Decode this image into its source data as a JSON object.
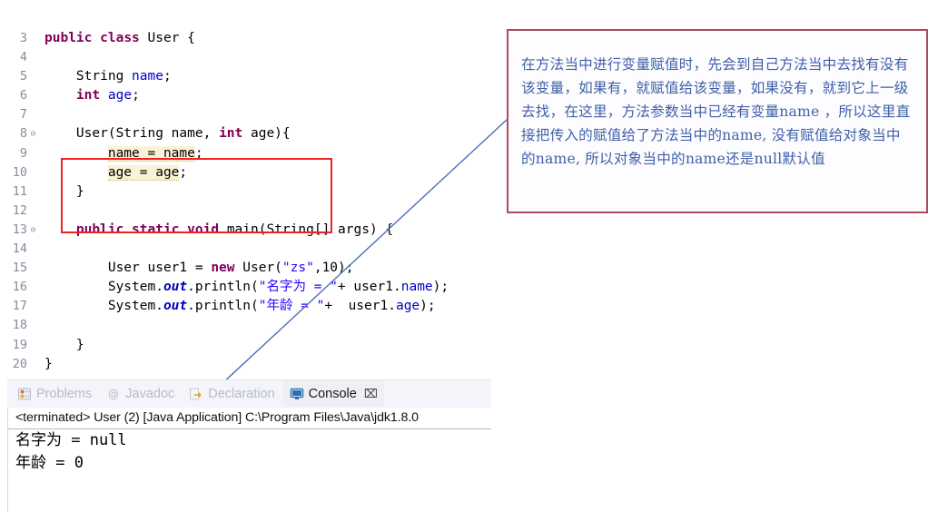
{
  "editor": {
    "name": "java-code-editor",
    "lines": [
      {
        "num": "3",
        "fold": false,
        "tokens": [
          {
            "t": "public",
            "c": "kw"
          },
          {
            "t": " ",
            "c": "plain"
          },
          {
            "t": "class",
            "c": "kw"
          },
          {
            "t": " User {",
            "c": "plain"
          }
        ]
      },
      {
        "num": "4",
        "fold": false,
        "tokens": [
          {
            "t": "",
            "c": "plain"
          }
        ]
      },
      {
        "num": "5",
        "fold": false,
        "tokens": [
          {
            "t": "    String ",
            "c": "plain"
          },
          {
            "t": "name",
            "c": "fld"
          },
          {
            "t": ";",
            "c": "plain"
          }
        ]
      },
      {
        "num": "6",
        "fold": false,
        "tokens": [
          {
            "t": "    ",
            "c": "plain"
          },
          {
            "t": "int",
            "c": "kw"
          },
          {
            "t": " ",
            "c": "plain"
          },
          {
            "t": "age",
            "c": "fld"
          },
          {
            "t": ";",
            "c": "plain"
          }
        ]
      },
      {
        "num": "7",
        "fold": false,
        "tokens": [
          {
            "t": "",
            "c": "plain"
          }
        ]
      },
      {
        "num": "8",
        "fold": true,
        "tokens": [
          {
            "t": "    User(String name, ",
            "c": "plain"
          },
          {
            "t": "int",
            "c": "kw"
          },
          {
            "t": " age){",
            "c": "plain"
          }
        ]
      },
      {
        "num": "9",
        "fold": false,
        "tokens": [
          {
            "t": "        ",
            "c": "plain"
          },
          {
            "t": "name = name",
            "c": "warn"
          },
          {
            "t": ";",
            "c": "plain"
          }
        ]
      },
      {
        "num": "10",
        "fold": false,
        "tokens": [
          {
            "t": "        ",
            "c": "plain"
          },
          {
            "t": "age = age",
            "c": "warn"
          },
          {
            "t": ";",
            "c": "plain"
          }
        ]
      },
      {
        "num": "11",
        "fold": false,
        "tokens": [
          {
            "t": "    }",
            "c": "plain"
          }
        ]
      },
      {
        "num": "12",
        "fold": false,
        "tokens": [
          {
            "t": "",
            "c": "plain"
          }
        ]
      },
      {
        "num": "13",
        "fold": true,
        "tokens": [
          {
            "t": "    ",
            "c": "plain"
          },
          {
            "t": "public",
            "c": "kw"
          },
          {
            "t": " ",
            "c": "plain"
          },
          {
            "t": "static",
            "c": "kw"
          },
          {
            "t": " ",
            "c": "plain"
          },
          {
            "t": "void",
            "c": "kw"
          },
          {
            "t": " main(String[] args) {",
            "c": "plain"
          }
        ]
      },
      {
        "num": "14",
        "fold": false,
        "tokens": [
          {
            "t": "",
            "c": "plain"
          }
        ]
      },
      {
        "num": "15",
        "fold": false,
        "tokens": [
          {
            "t": "        User user1 = ",
            "c": "plain"
          },
          {
            "t": "new",
            "c": "kw"
          },
          {
            "t": " User(",
            "c": "plain"
          },
          {
            "t": "\"zs\"",
            "c": "str"
          },
          {
            "t": ",10);",
            "c": "plain"
          }
        ]
      },
      {
        "num": "16",
        "fold": false,
        "tokens": [
          {
            "t": "        System.",
            "c": "plain"
          },
          {
            "t": "out",
            "c": "stat"
          },
          {
            "t": ".println(",
            "c": "plain"
          },
          {
            "t": "\"名字为 = \"",
            "c": "str"
          },
          {
            "t": "+ user1.",
            "c": "plain"
          },
          {
            "t": "name",
            "c": "fld"
          },
          {
            "t": ");",
            "c": "plain"
          }
        ]
      },
      {
        "num": "17",
        "fold": false,
        "tokens": [
          {
            "t": "        System.",
            "c": "plain"
          },
          {
            "t": "out",
            "c": "stat"
          },
          {
            "t": ".println(",
            "c": "plain"
          },
          {
            "t": "\"年龄 = \"",
            "c": "str"
          },
          {
            "t": "+  user1.",
            "c": "plain"
          },
          {
            "t": "age",
            "c": "fld"
          },
          {
            "t": ");",
            "c": "plain"
          }
        ]
      },
      {
        "num": "18",
        "fold": false,
        "tokens": [
          {
            "t": "",
            "c": "plain"
          }
        ]
      },
      {
        "num": "19",
        "fold": false,
        "tokens": [
          {
            "t": "    }",
            "c": "plain"
          }
        ]
      },
      {
        "num": "20",
        "fold": false,
        "tokens": [
          {
            "t": "}",
            "c": "plain"
          }
        ]
      }
    ],
    "fold_glyph": "⊖"
  },
  "annotation": {
    "text": "在方法当中进行变量赋值时，先会到自己方法当中去找有没有该变量，如果有，就赋值给该变量，如果没有，就到它上一级去找，在这里，方法参数当中已经有变量name ，所以这里直接把传入的赋值给了方法当中的name, 没有赋值给对象当中的name, 所以对象当中的name还是null默认值",
    "border_color": "#b04a5a",
    "text_color": "#3f5fa8"
  },
  "highlight": {
    "constructor_box_color": "#ee2222"
  },
  "connector": {
    "color": "#4a6fb5"
  },
  "console": {
    "tabs": [
      {
        "label": "Problems",
        "icon": "problems-icon",
        "active": false,
        "closable": false
      },
      {
        "label": "Javadoc",
        "icon": "javadoc-icon",
        "active": false,
        "closable": false
      },
      {
        "label": "Declaration",
        "icon": "declaration-icon",
        "active": false,
        "closable": false
      },
      {
        "label": "Console",
        "icon": "console-icon",
        "active": true,
        "closable": true
      }
    ],
    "close_glyph": "⌧",
    "launch_line": "<terminated> User (2) [Java Application] C:\\Program Files\\Java\\jdk1.8.0",
    "output_lines": [
      "名字为 = null",
      "年龄 = 0"
    ]
  }
}
